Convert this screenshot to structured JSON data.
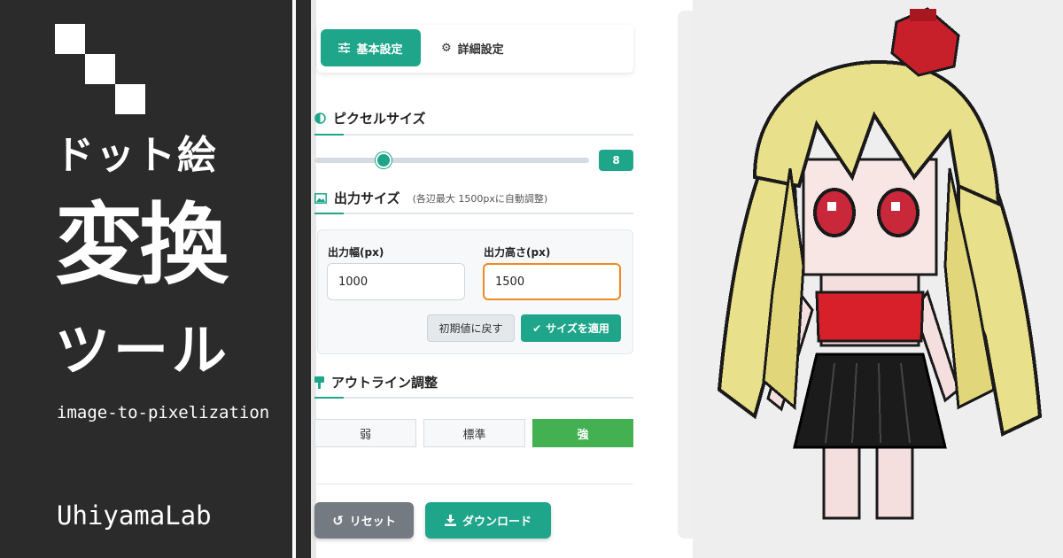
{
  "banner": {
    "title_line1": "ドット絵",
    "title_line2": "変換",
    "title_line3": "ツール",
    "subtitle": "image-to-pixelization",
    "brand": "UhiyamaLab"
  },
  "tabs": [
    {
      "label": "基本設定",
      "icon": "sliders-icon",
      "active": true
    },
    {
      "label": "詳細設定",
      "icon": "gear-icon",
      "active": false
    }
  ],
  "pixel_size": {
    "heading": "ピクセルサイズ",
    "icon": "contrast-icon",
    "value": "8",
    "slider_fraction": 0.25
  },
  "output_size": {
    "heading": "出力サイズ",
    "icon": "image-icon",
    "note": "(各辺最大 1500pxに自動調整)",
    "width_label": "出力幅(px)",
    "width_value": "1000",
    "height_label": "出力高さ(px)",
    "height_value": "1500",
    "reset_label": "初期値に戻す",
    "apply_label": "サイズを適用"
  },
  "outline": {
    "heading": "アウトライン調整",
    "icon": "brush-icon",
    "options": [
      "弱",
      "標準",
      "強"
    ],
    "selected": "強"
  },
  "actions": {
    "reset_label": "リセット",
    "download_label": "ダウンロード"
  },
  "colors": {
    "accent": "#1fa58a",
    "selected_option": "#43b052",
    "banner_bg": "#2b2b2b",
    "focus_border": "#f08a24"
  }
}
